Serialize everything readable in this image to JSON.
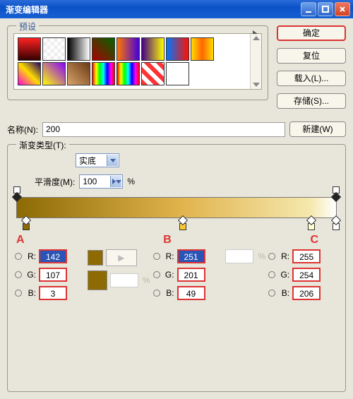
{
  "title": "渐变编辑器",
  "buttons": {
    "ok": "确定",
    "reset": "复位",
    "load": "载入(L)...",
    "save": "存储(S)...",
    "new": "新建(W)"
  },
  "presets_label": "预设",
  "name_label": "名称(N):",
  "name_value": "200",
  "type_label": "渐变类型(T):",
  "type_value": "实底",
  "smooth_label": "平滑度(M):",
  "smooth_value": "100",
  "percent": "%",
  "stopA": {
    "letter": "A",
    "pos_pct": 3,
    "R": "142",
    "G": "107",
    "B": "3"
  },
  "stopB": {
    "letter": "B",
    "pos_pct": 52,
    "R": "251",
    "G": "201",
    "B": "49"
  },
  "stopC": {
    "letter": "C",
    "pos_pct": 92,
    "R": "255",
    "G": "254",
    "B": "206"
  },
  "chan": {
    "R": "R:",
    "G": "G:",
    "B": "B:"
  }
}
